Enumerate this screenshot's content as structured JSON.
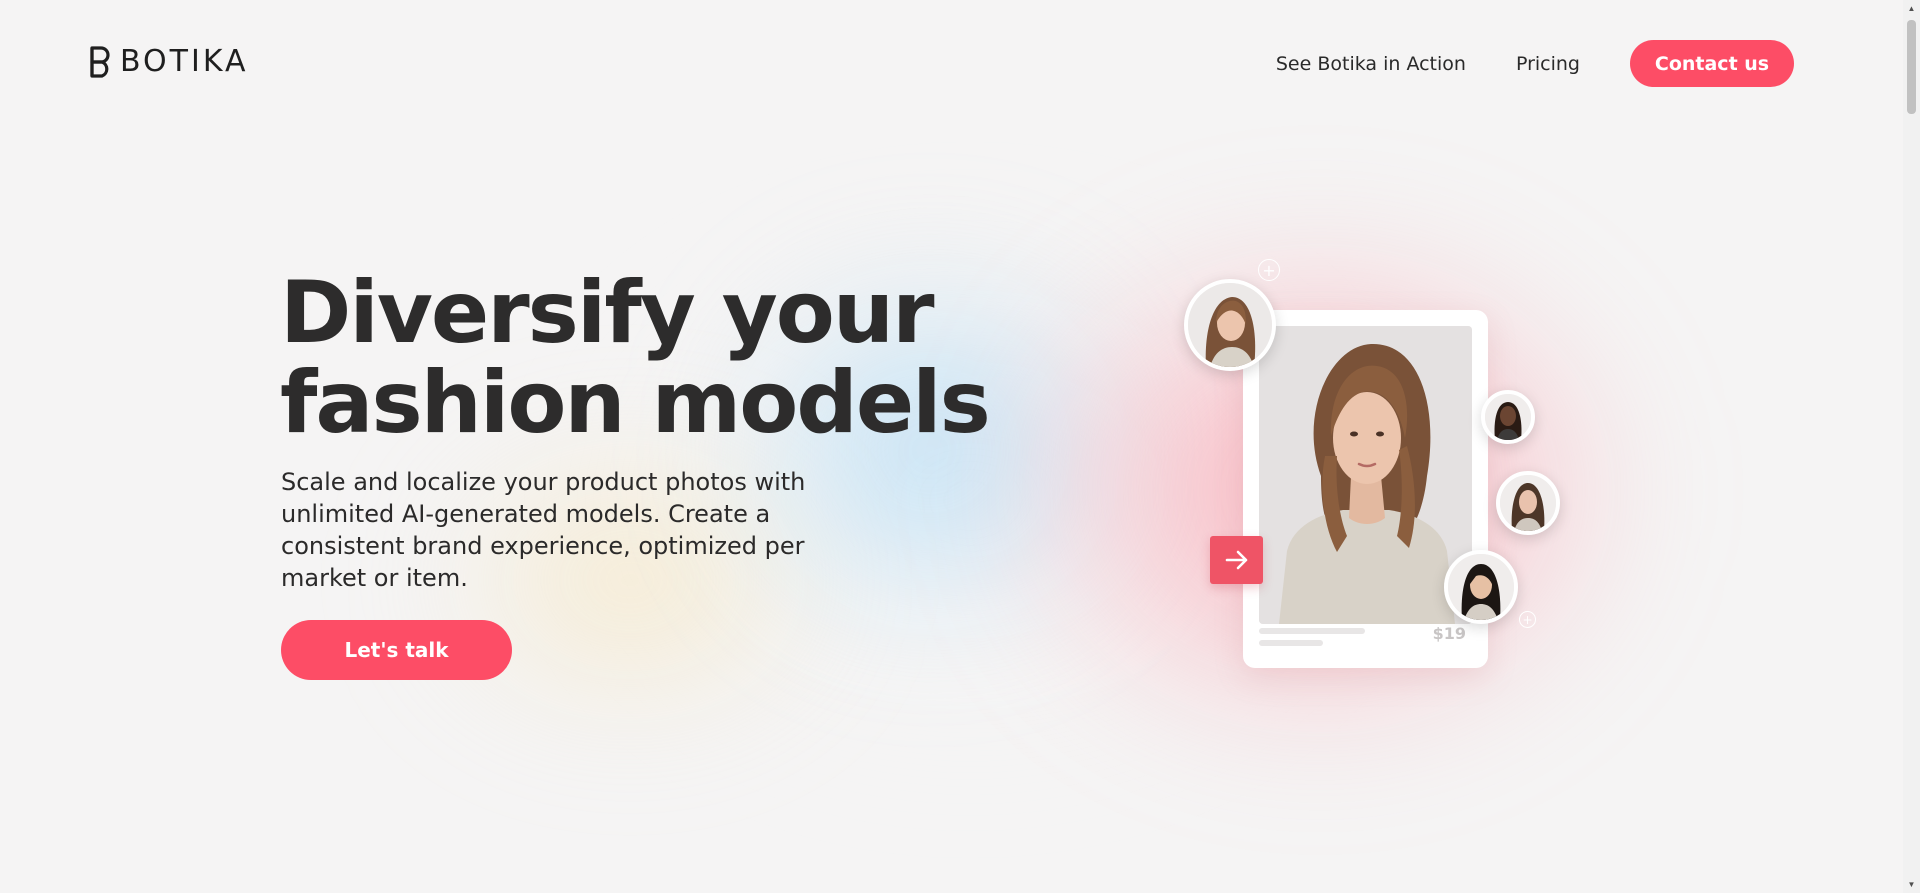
{
  "brand": {
    "name": "BOTIKA",
    "accent_color": "#fd4d66"
  },
  "nav": {
    "items": [
      {
        "label": "See Botika in Action"
      },
      {
        "label": "Pricing"
      }
    ],
    "contact_label": "Contact us"
  },
  "hero": {
    "title_line1": "Diversify your",
    "title_line2": "fashion models",
    "subtitle": "Scale and localize your product photos with unlimited AI-generated models. Create a consistent brand experience, optimized per market or item.",
    "cta_label": "Let's talk"
  },
  "illustration": {
    "price": "$19",
    "arrow_icon": "arrow-right-icon",
    "plus_icon": "plus-icon"
  }
}
